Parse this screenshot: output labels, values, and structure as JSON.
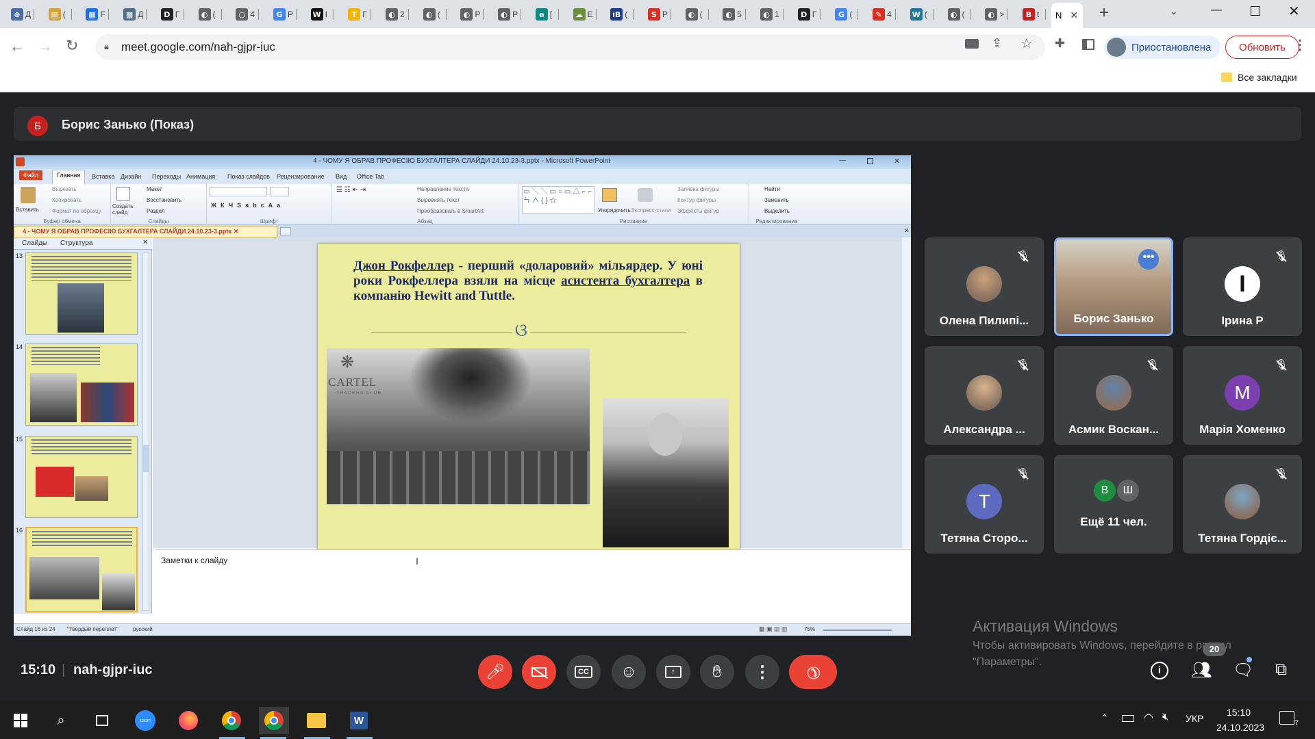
{
  "browser": {
    "tabs": [
      {
        "icon": "chrome-icon",
        "color": "#4a6da7",
        "char": "⊕",
        "label": "Д"
      },
      {
        "icon": "store-icon",
        "color": "#d4a23a",
        "char": "▤",
        "label": "("
      },
      {
        "icon": "doc-icon",
        "color": "#1a73e8",
        "char": "▦",
        "label": "F"
      },
      {
        "icon": "img-icon",
        "color": "#4e6f8a",
        "char": "▩",
        "label": "Д"
      },
      {
        "icon": "d-icon",
        "color": "#202124",
        "char": "D",
        "label": "Г"
      },
      {
        "icon": "circle-icon",
        "color": "#5f6368",
        "char": "◐",
        "label": "("
      },
      {
        "icon": "circle-icon",
        "color": "#5f6368",
        "char": "○",
        "label": "4"
      },
      {
        "icon": "google-icon",
        "color": "#4285f4",
        "char": "G",
        "label": "Р"
      },
      {
        "icon": "w-icon",
        "color": "#111111",
        "char": "W",
        "label": "I"
      },
      {
        "icon": "t-icon",
        "color": "#f4b400",
        "char": "T",
        "label": "Г"
      },
      {
        "icon": "circle-icon",
        "color": "#5f6368",
        "char": "◐",
        "label": "2"
      },
      {
        "icon": "circle-icon",
        "color": "#5f6368",
        "char": "◐",
        "label": "("
      },
      {
        "icon": "circle-icon",
        "color": "#5f6368",
        "char": "◐",
        "label": "Р"
      },
      {
        "icon": "circle-icon",
        "color": "#5f6368",
        "char": "◐",
        "label": "Р"
      },
      {
        "icon": "e-icon",
        "color": "#0a8a80",
        "char": "e",
        "label": "["
      },
      {
        "icon": "cloud-icon",
        "color": "#6b8f3a",
        "char": "☁",
        "label": "Е"
      },
      {
        "icon": "ib-icon",
        "color": "#1a3a8a",
        "char": "iB",
        "label": "("
      },
      {
        "icon": "s-icon",
        "color": "#d93025",
        "char": "S",
        "label": "Р"
      },
      {
        "icon": "circle-icon",
        "color": "#5f6368",
        "char": "◐",
        "label": "("
      },
      {
        "icon": "circle-icon",
        "color": "#5f6368",
        "char": "◐",
        "label": "5"
      },
      {
        "icon": "circle-icon",
        "color": "#5f6368",
        "char": "◐",
        "label": "1"
      },
      {
        "icon": "d-icon",
        "color": "#202124",
        "char": "D",
        "label": "Г"
      },
      {
        "icon": "google-icon",
        "color": "#4285f4",
        "char": "G",
        "label": "("
      },
      {
        "icon": "pen-icon",
        "color": "#d93025",
        "char": "✎",
        "label": "4"
      },
      {
        "icon": "wordpress-icon",
        "color": "#21759b",
        "char": "W",
        "label": "("
      },
      {
        "icon": "circle-icon",
        "color": "#5f6368",
        "char": "◐",
        "label": "("
      },
      {
        "icon": "circle-icon",
        "color": "#5f6368",
        "char": "◐",
        "label": ">"
      },
      {
        "icon": "b-icon",
        "color": "#c5221f",
        "char": "B",
        "label": "t"
      }
    ],
    "active_tab_label": "N",
    "url": "meet.google.com/nah-gjpr-iuc",
    "profile_label": "Приостановлена",
    "update_label": "Обновить",
    "bookmarks_label": "Все закладки"
  },
  "meet": {
    "presenter_initial": "Б",
    "presenter_label": "Борис Занько (Показ)",
    "time": "15:10",
    "meeting_code": "nah-gjpr-iuc",
    "participants_count": "20",
    "participants": [
      {
        "name": "Олена Пилипі...",
        "avatar": "photo",
        "color": "#c9a27a",
        "muted": true
      },
      {
        "name": "Борис Занько",
        "avatar": "video",
        "color": "#a88a6d",
        "muted": false
      },
      {
        "name": "Ірина Р",
        "avatar": "I",
        "color": "#ffffff",
        "muted": true
      },
      {
        "name": "Александра ...",
        "avatar": "photo",
        "color": "#d8b48f",
        "muted": true
      },
      {
        "name": "Асмик Воскан...",
        "avatar": "photo",
        "color": "#5f83a8",
        "muted": true
      },
      {
        "name": "Марія Хоменко",
        "avatar": "M",
        "color": "#7b3fb0",
        "muted": true
      },
      {
        "name": "Тетяна Сторо...",
        "avatar": "T",
        "color": "#5c6bc0",
        "muted": true
      },
      {
        "name": "Ещё 11 чел.",
        "avatar": "group",
        "color": "#3c4043",
        "muted": false
      },
      {
        "name": "Тетяна Гордіє...",
        "avatar": "photo",
        "color": "#7aa7c7",
        "muted": true
      }
    ],
    "group_initials": [
      "В",
      "Ш"
    ],
    "watermark_title": "Активация Windows",
    "watermark_line1": "Чтобы активировать Windows, перейдите в раздел",
    "watermark_line2": "\"Параметры\"."
  },
  "ppt": {
    "window_title": "4 - ЧОМУ Я ОБРАВ ПРОФЕСІЮ БУХГАЛТЕРА СЛАЙДИ 24.10.23-3.pptx - Microsoft PowerPoint",
    "ribbon_tabs": [
      "Файл",
      "Главная",
      "Вставка",
      "Дизайн",
      "Переходы",
      "Анимация",
      "Показ слайдов",
      "Рецензирование",
      "Вид",
      "Office Tab"
    ],
    "groups": [
      "Буфер обмена",
      "Слайды",
      "Шрифт",
      "Абзац",
      "Рисование",
      "Редактирование"
    ],
    "clipboard_items": [
      "Вырезать",
      "Копировать",
      "Формат по образцу"
    ],
    "paste_label": "Вставить",
    "create_slide_label": "Создать слайд",
    "slides_items": [
      "Макет",
      "Восстановить",
      "Раздел"
    ],
    "para_items": [
      "Направление текста",
      "Выровнять текст",
      "Преобразовать в SmartArt"
    ],
    "arrange_label": "Упорядочить",
    "styles_label": "Экспресс-стили",
    "draw_items": [
      "Заливка фигуры",
      "Контур фигуры",
      "Эффекты фигур"
    ],
    "edit_items": [
      "Найти",
      "Заменить",
      "Выделить"
    ],
    "doc_tab": "4 - ЧОМУ Я ОБРАВ ПРОФЕСІЮ БУХГАЛТЕРА СЛАЙДИ 24.10.23-3.pptx",
    "panel_tabs": [
      "Слайды",
      "Структура"
    ],
    "thumb_numbers": [
      "13",
      "14",
      "15",
      "16"
    ],
    "slide_text_link1": "Джон Рокфеллер",
    "slide_text_1": " - перший «доларовий» мільярдер. У юні роки Рокфеллера взяли на місце ",
    "slide_text_link2": "асистента бухгалтера",
    "slide_text_2": " в компанію Hewitt and Tuttle.",
    "slide_logo_text": "CARTEL",
    "slide_logo_sub": "TRADERS CLUB",
    "notes_placeholder": "Заметки к слайду",
    "status_slide": "Слайд 16 из 24",
    "status_theme": "\"Твердый переплет\"",
    "status_lang": "русский",
    "zoom": "75%"
  },
  "taskbar": {
    "time": "15:10",
    "date": "24.10.2023",
    "lang": "УКР",
    "notif_count": "7"
  }
}
